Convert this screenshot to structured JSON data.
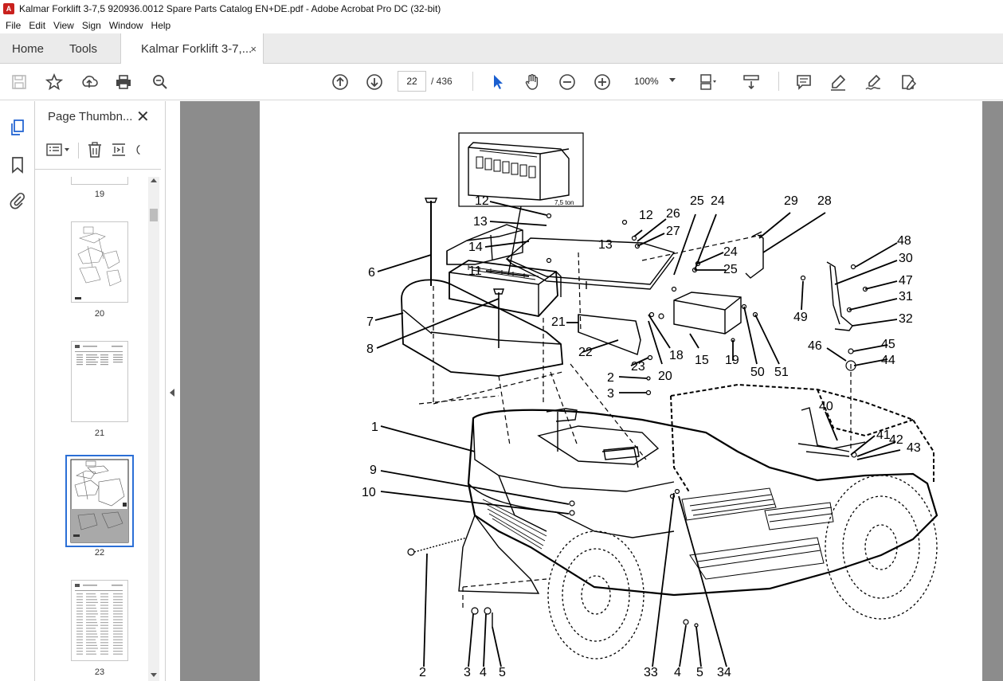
{
  "window": {
    "title": "Kalmar Forklift 3-7,5 920936.0012 Spare Parts Catalog EN+DE.pdf - Adobe Acrobat Pro DC (32-bit)",
    "app_icon": "pdf-icon"
  },
  "menu": {
    "items": [
      "File",
      "Edit",
      "View",
      "Sign",
      "Window",
      "Help"
    ]
  },
  "tabs": {
    "home": "Home",
    "tools": "Tools",
    "document": "Kalmar Forklift 3-7,...",
    "close": "×"
  },
  "toolbar": {
    "icons": [
      "save-icon",
      "star-icon",
      "upload-icon",
      "print-icon",
      "search-zoom-icon",
      "page-up-icon",
      "page-down-icon",
      "select-cursor-icon",
      "hand-icon",
      "zoom-out-icon",
      "zoom-in-icon",
      "fit-page-icon",
      "scroll-mode-icon",
      "comment-icon",
      "highlight-icon",
      "sign-icon",
      "edit-pdf-icon"
    ],
    "current_page": "22",
    "total_pages": "/ 436",
    "zoom": "100%"
  },
  "sidebar": {
    "panel_title": "Page Thumbn...",
    "close": "✕",
    "thumbnails": [
      {
        "label": "19"
      },
      {
        "label": "20"
      },
      {
        "label": "21"
      },
      {
        "label": "22",
        "selected": true
      },
      {
        "label": "23"
      }
    ]
  },
  "drawing": {
    "inset_label": "7,5 ton",
    "callouts": [
      "12",
      "13",
      "14",
      "11",
      "6",
      "7",
      "8",
      "21",
      "22",
      "23",
      "2",
      "3",
      "18",
      "20",
      "15",
      "19",
      "50",
      "51",
      "12",
      "26",
      "27",
      "13",
      "25",
      "24",
      "24",
      "25",
      "29",
      "28",
      "48",
      "30",
      "47",
      "49",
      "31",
      "32",
      "46",
      "45",
      "44",
      "40",
      "41",
      "42",
      "43",
      "1",
      "9",
      "10",
      "2",
      "3",
      "4",
      "5",
      "33",
      "4",
      "5",
      "34"
    ]
  },
  "colors": {
    "viewer_bg": "#8c8c8c",
    "selection": "#2b6fd6",
    "cursor_blue": "#1a5fd0"
  }
}
